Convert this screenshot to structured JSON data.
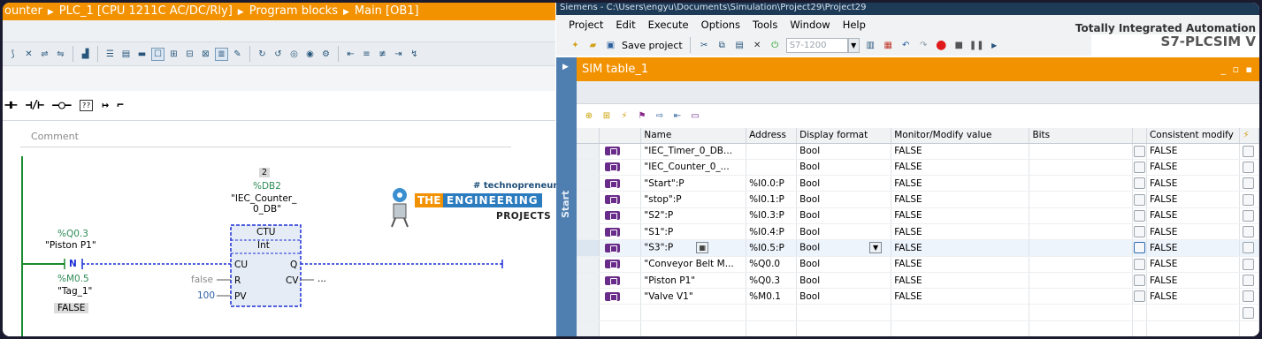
{
  "left": {
    "breadcrumb": [
      "ounter",
      "PLC_1 [CPU 1211C AC/DC/Rly]",
      "Program blocks",
      "Main [OB1]"
    ],
    "comment_placeholder": "Comment",
    "counter_block": {
      "instance_number": "2",
      "db_name": "%DB2",
      "db_tag_line1": "\"IEC_Counter_",
      "db_tag_line2": "0_DB\"",
      "type": "CTU",
      "datatype": "Int",
      "pin_cu": "CU",
      "pin_r": "R",
      "pin_pv": "PV",
      "pin_q": "Q",
      "pin_cv": "CV",
      "r_value": "false",
      "pv_value": "100",
      "cv_value": "..."
    },
    "contact": {
      "address": "%Q0.3",
      "tag": "\"Piston P1\"",
      "edge_label": "N",
      "mem_address": "%M0.5",
      "mem_tag": "\"Tag_1\"",
      "mem_value": "FALSE"
    },
    "watermark": {
      "hashtag": "# technopreneur",
      "the": "THE",
      "engineering": "ENGINEERING",
      "projects": "PROJECTS"
    }
  },
  "right": {
    "titlebar": "Siemens - C:\\Users\\engyu\\Documents\\Simulation\\Project29\\Project29",
    "menu": [
      "Project",
      "Edit",
      "Execute",
      "Options",
      "Tools",
      "Window",
      "Help"
    ],
    "brand_line1": "Totally Integrated Automation",
    "brand_line2": "S7-PLCSIM V",
    "toolbar": {
      "save_label": "Save project",
      "cpu_placeholder": "S7-1200"
    },
    "side_label": "Start",
    "sim_table_title": "SIM table_1",
    "columns": [
      "",
      "",
      "Name",
      "Address",
      "Display format",
      "Monitor/Modify value",
      "Bits",
      "",
      "Consistent modify",
      "⚡"
    ],
    "rows": [
      {
        "name": "\"IEC_Timer_0_DB...",
        "address": "",
        "format": "Bool",
        "value": "FALSE",
        "consistent": "FALSE"
      },
      {
        "name": "\"IEC_Counter_0_...",
        "address": "",
        "format": "Bool",
        "value": "FALSE",
        "consistent": "FALSE"
      },
      {
        "name": "\"Start\":P",
        "address": "%I0.0:P",
        "format": "Bool",
        "value": "FALSE",
        "consistent": "FALSE"
      },
      {
        "name": "\"stop\":P",
        "address": "%I0.1:P",
        "format": "Bool",
        "value": "FALSE",
        "consistent": "FALSE"
      },
      {
        "name": "\"S2\":P",
        "address": "%I0.3:P",
        "format": "Bool",
        "value": "FALSE",
        "consistent": "FALSE"
      },
      {
        "name": "\"S1\":P",
        "address": "%I0.4:P",
        "format": "Bool",
        "value": "FALSE",
        "consistent": "FALSE"
      },
      {
        "name": "\"S3\":P",
        "address": "%I0.5:P",
        "format": "Bool",
        "value": "FALSE",
        "consistent": "FALSE"
      },
      {
        "name": "\"Conveyor Belt M...",
        "address": "%Q0.0",
        "format": "Bool",
        "value": "FALSE",
        "consistent": "FALSE"
      },
      {
        "name": "\"Piston P1\"",
        "address": "%Q0.3",
        "format": "Bool",
        "value": "FALSE",
        "consistent": "FALSE"
      },
      {
        "name": "\"Valve V1\"",
        "address": "%M0.1",
        "format": "Bool",
        "value": "FALSE",
        "consistent": "FALSE"
      }
    ]
  },
  "colors": {
    "accent_orange": "#f39200",
    "side_blue": "#4f7eb0",
    "tag_purple": "#6a2c8a",
    "ladder_blue": "#1a2fd6"
  }
}
